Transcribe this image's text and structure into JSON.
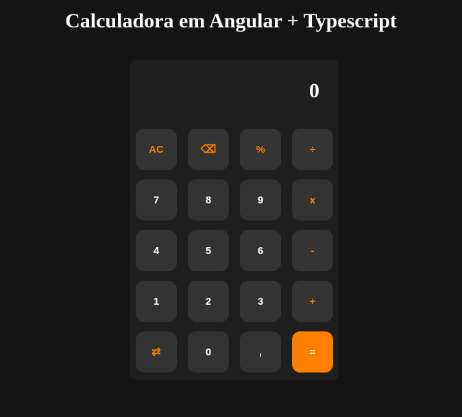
{
  "page": {
    "title": "Calculadora em Angular + Typescript"
  },
  "display": {
    "value": "0"
  },
  "keys": {
    "clear": "AC",
    "backspace": "⌫",
    "percent": "%",
    "divide": "÷",
    "seven": "7",
    "eight": "8",
    "nine": "9",
    "multiply": "x",
    "four": "4",
    "five": "5",
    "six": "6",
    "subtract": "-",
    "one": "1",
    "two": "2",
    "three": "3",
    "add": "+",
    "toggle_sign": "⇄",
    "zero": "0",
    "decimal": ",",
    "equals": "="
  },
  "icons": {
    "backspace": "backspace-icon",
    "toggle_sign": "swap-arrows-icon"
  },
  "colors": {
    "accent": "#ff8000",
    "key_background": "#333333",
    "panel_background": "#1e1e1e",
    "page_background": "#141414"
  }
}
